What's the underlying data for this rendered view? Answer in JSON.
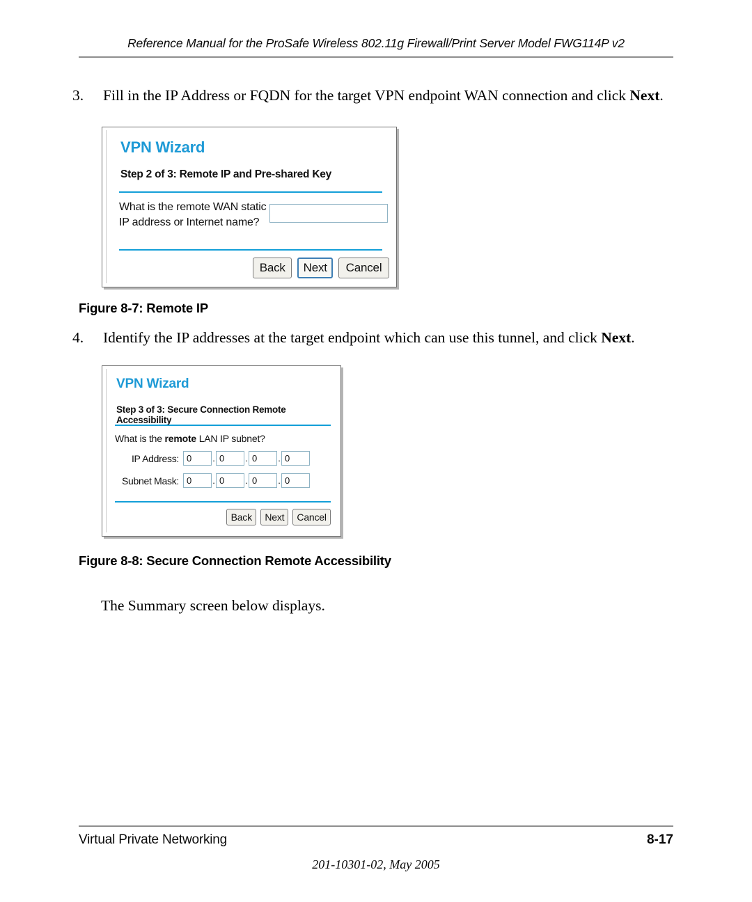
{
  "header": {
    "text": "Reference Manual for the ProSafe Wireless 802.11g  Firewall/Print Server Model FWG114P v2"
  },
  "steps": [
    {
      "number": "3.",
      "text_before": "Fill in the IP Address or FQDN for the target VPN endpoint WAN connection and click ",
      "bold": "Next",
      "text_after": "."
    },
    {
      "number": "4.",
      "text_before": "Identify the IP addresses at the target endpoint which can use this tunnel, and click ",
      "bold": "Next",
      "text_after": "."
    }
  ],
  "figures": [
    {
      "caption": "Figure 8-7:  Remote IP"
    },
    {
      "caption": "Figure 8-8:  Secure Connection Remote Accessibility"
    }
  ],
  "paragraph": {
    "summary": "The Summary screen below displays."
  },
  "wizard_remote_ip": {
    "title": "VPN Wizard",
    "step_heading": "Step 2 of 3: Remote IP and Pre-shared Key",
    "question": "What is the remote WAN static IP address or Internet name?",
    "input_value": "",
    "input_placeholder": "",
    "buttons": {
      "back": "Back",
      "next": "Next",
      "cancel": "Cancel"
    }
  },
  "wizard_remote_accessibility": {
    "title": "VPN Wizard",
    "step_heading": "Step 3 of 3: Secure Connection Remote Accessibility",
    "question_prefix": "What is the ",
    "question_bold": "remote",
    "question_suffix": " LAN IP subnet?",
    "fields": [
      {
        "label": "IP Address:",
        "octets": [
          "0",
          "0",
          "0",
          "0"
        ]
      },
      {
        "label": "Subnet Mask:",
        "octets": [
          "0",
          "0",
          "0",
          "0"
        ]
      }
    ],
    "separator": ".",
    "buttons": {
      "back": "Back",
      "next": "Next",
      "cancel": "Cancel"
    }
  },
  "footer": {
    "section": "Virtual Private Networking",
    "page_number": "8-17",
    "document_id": "201-10301-02, May 2005"
  },
  "colors": {
    "wizard_title_blue": "#1e9ad6",
    "rule_blue": "#139fd8",
    "input_border": "#8fb3c4",
    "page_rule_gray": "#8e8e8e"
  }
}
